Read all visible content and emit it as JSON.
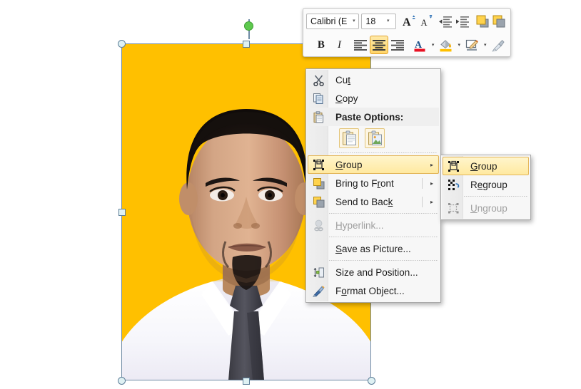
{
  "app": {
    "context": "presentation-slide-editor",
    "slide_background": "#FFFFFF"
  },
  "picture_object": {
    "name": "selected-picture",
    "background_color": "#FFC000",
    "description": "Portrait photo of a man in a white shirt and dark grey tie on an amber background",
    "selected": true,
    "handles": [
      "top-left",
      "top-center",
      "top-right",
      "middle-left",
      "middle-right",
      "bottom-left",
      "bottom-center",
      "bottom-right"
    ],
    "rotation_handle": "rotate-handle"
  },
  "mini_toolbar": {
    "font_name": "Calibri (E",
    "font_name_arrow": "▾",
    "font_size": "18",
    "font_size_arrow": "▾",
    "row1": [
      {
        "name": "grow-font-button",
        "label": "A",
        "icon": "grow-font-icon"
      },
      {
        "name": "shrink-font-button",
        "label": "A",
        "icon": "shrink-font-icon"
      },
      {
        "name": "decrease-indent-button",
        "label": "",
        "icon": "decrease-indent-icon"
      },
      {
        "name": "increase-indent-button",
        "label": "",
        "icon": "increase-indent-icon"
      },
      {
        "name": "bring-forward-button",
        "label": "",
        "icon": "bring-forward-icon"
      },
      {
        "name": "send-backward-button",
        "label": "",
        "icon": "send-backward-icon"
      }
    ],
    "row2": [
      {
        "name": "bold-button",
        "label": "B",
        "icon": "bold-icon",
        "active": false
      },
      {
        "name": "italic-button",
        "label": "I",
        "icon": "italic-icon",
        "active": false
      },
      {
        "name": "align-left-button",
        "label": "",
        "icon": "align-left-icon",
        "active": false
      },
      {
        "name": "align-center-button",
        "label": "",
        "icon": "align-center-icon",
        "active": true
      },
      {
        "name": "align-right-button",
        "label": "",
        "icon": "align-right-icon",
        "active": false
      },
      {
        "name": "font-color-button",
        "label": "A",
        "icon": "font-color-icon",
        "color": "#E81123"
      },
      {
        "name": "fill-color-button",
        "label": "",
        "icon": "fill-color-icon",
        "color": "#FFC000"
      },
      {
        "name": "shape-outline-button",
        "label": "",
        "icon": "shape-style-icon"
      },
      {
        "name": "format-painter-button",
        "label": "",
        "icon": "format-painter-icon"
      }
    ]
  },
  "context_menu": {
    "items": [
      {
        "label": "Cut",
        "accel": "t",
        "icon": "scissors-icon",
        "enabled": true,
        "bold": false,
        "submenu": false
      },
      {
        "label": "Copy",
        "accel": "C",
        "icon": "copy-icon",
        "enabled": true,
        "bold": false,
        "submenu": false
      },
      {
        "label": "Paste Options:",
        "accel": "",
        "icon": "paste-icon",
        "enabled": true,
        "bold": true,
        "submenu": false
      }
    ],
    "paste_options": [
      {
        "name": "paste-keep-source-formatting-button",
        "icon": "clipboard-document-icon"
      },
      {
        "name": "paste-picture-button",
        "icon": "clipboard-picture-icon"
      }
    ],
    "items2": [
      {
        "label": "Group",
        "accel": "G",
        "icon": "group-icon",
        "enabled": true,
        "highlighted": true,
        "submenu": true
      },
      {
        "label": "Bring to Front",
        "accel": "F",
        "icon": "bring-to-front-icon",
        "enabled": true,
        "highlighted": false,
        "submenu": true
      },
      {
        "label": "Send to Back",
        "accel": "k",
        "icon": "send-to-back-icon",
        "enabled": true,
        "highlighted": false,
        "submenu": true
      }
    ],
    "items3": [
      {
        "label": "Hyperlink...",
        "accel": "H",
        "icon": "hyperlink-icon",
        "enabled": false,
        "submenu": false
      },
      {
        "label": "Save as Picture...",
        "accel": "S",
        "icon": "",
        "enabled": true,
        "submenu": false
      },
      {
        "label": "Size and Position...",
        "accel": "",
        "icon": "size-position-icon",
        "enabled": true,
        "submenu": false
      },
      {
        "label": "Format Object...",
        "accel": "o",
        "icon": "format-object-icon",
        "enabled": true,
        "submenu": false
      }
    ],
    "submenu_arrow": "▸"
  },
  "group_submenu": {
    "items": [
      {
        "label": "Group",
        "accel": "G",
        "icon": "group-icon",
        "enabled": true,
        "highlighted": true
      },
      {
        "label": "Regroup",
        "accel": "e",
        "icon": "regroup-icon",
        "enabled": true,
        "highlighted": false
      },
      {
        "label": "Ungroup",
        "accel": "U",
        "icon": "ungroup-icon",
        "enabled": false,
        "highlighted": false
      }
    ]
  },
  "colors": {
    "amber": "#FFC000",
    "selection_border": "#6F8BA4",
    "rotate_handle": "#5EC94E",
    "menu_highlight_border": "#E3B558"
  }
}
